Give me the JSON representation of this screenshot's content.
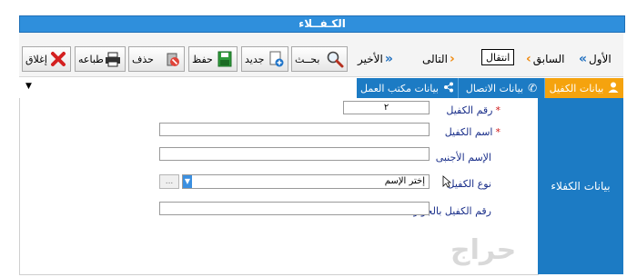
{
  "window": {
    "title": "الكـفــلاء"
  },
  "toolbar": {
    "buttons": {
      "close": "إغلاق",
      "print": "طباعه",
      "delete": "حذف",
      "save": "حفظ",
      "new": "جديد",
      "search": "بحــث"
    },
    "nav": {
      "last": "الأخير",
      "next": "التالى",
      "goto": "انتقال",
      "prev": "السابق",
      "first": "الأول"
    }
  },
  "tabs": {
    "guarantor": "بيانات الكفيل",
    "contact": "بيانات الاتصال",
    "office": "بيانات مكتب العمل"
  },
  "side_panel": {
    "label": "بيانات الكفلاء"
  },
  "form": {
    "guarantor_no": {
      "label": "رقم الكفيل",
      "value": "٢"
    },
    "guarantor_name": {
      "label": "اسم الكفيل",
      "value": ""
    },
    "foreign_name": {
      "label": "الإسم الأجنبى",
      "value": ""
    },
    "guarantor_type": {
      "label": "نوع الكفيل",
      "value": "إختر الإسم"
    },
    "passport_no": {
      "label": "رقم الكفيل بالجوازات",
      "value": ""
    },
    "lookup_button": "..."
  },
  "watermark": {
    "text": "حراج"
  },
  "colors": {
    "title_blue": "#2f8fdc",
    "tab_blue": "#1c7bc4",
    "active_orange": "#f5a30e",
    "label_navy": "#1a2f8a"
  }
}
